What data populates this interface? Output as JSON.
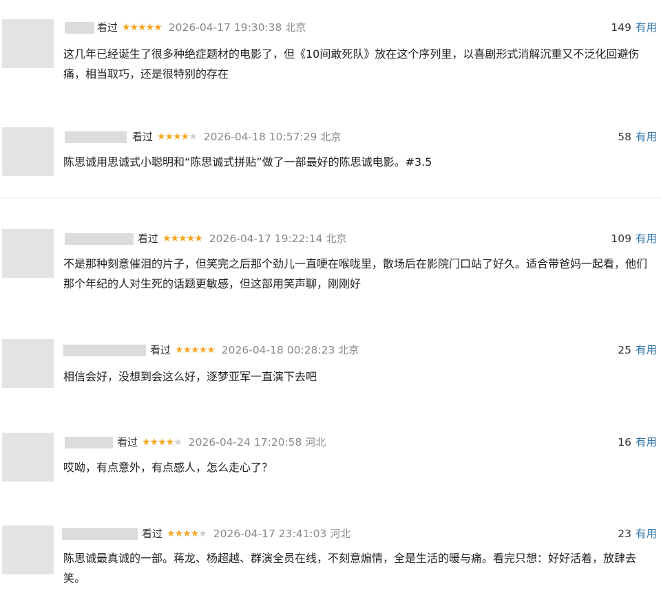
{
  "reviews": [
    {
      "status": "看过",
      "rating": 5,
      "time": "2026-04-17 19:30:38",
      "location": "北京",
      "votes": "149",
      "vote_label": "有用",
      "content": "这几年已经诞生了很多种绝症题材的电影了，但《10间敢死队》放在这个序列里，以喜剧形式消解沉重又不泛化回避伤痛，相当取巧，还是很特别的存在"
    },
    {
      "status": "看过",
      "rating": 4,
      "time": "2026-04-18 10:57:29",
      "location": "北京",
      "votes": "58",
      "vote_label": "有用",
      "content": "陈思诚用思诚式小聪明和“陈思诚式拼贴”做了一部最好的陈思诚电影。#3.5"
    },
    {
      "status": "看过",
      "rating": 5,
      "time": "2026-04-17 19:22:14",
      "location": "北京",
      "votes": "109",
      "vote_label": "有用",
      "content": "不是那种刻意催泪的片子，但笑完之后那个劲儿一直哽在喉咙里，散场后在影院门口站了好久。适合带爸妈一起看，他们那个年纪的人对生死的话题更敏感，但这部用笑声聊，刚刚好"
    },
    {
      "status": "看过",
      "rating": 5,
      "time": "2026-04-18 00:28:23",
      "location": "北京",
      "votes": "25",
      "vote_label": "有用",
      "content": "相信会好，没想到会这么好，逐梦亚军一直演下去吧"
    },
    {
      "status": "看过",
      "rating": 4,
      "time": "2026-04-24 17:20:58",
      "location": "河北",
      "votes": "16",
      "vote_label": "有用",
      "content": "哎呦，有点意外，有点感人，怎么走心了？"
    },
    {
      "status": "看过",
      "rating": 4,
      "time": "2026-04-17 23:41:03",
      "location": "河北",
      "votes": "23",
      "vote_label": "有用",
      "content": "陈思诚最真诚的一部。蒋龙、杨超越、群演全员在线，不刻意煽情，全是生活的暖与痛。看完只想：好好活着，放肆去笑。"
    }
  ]
}
